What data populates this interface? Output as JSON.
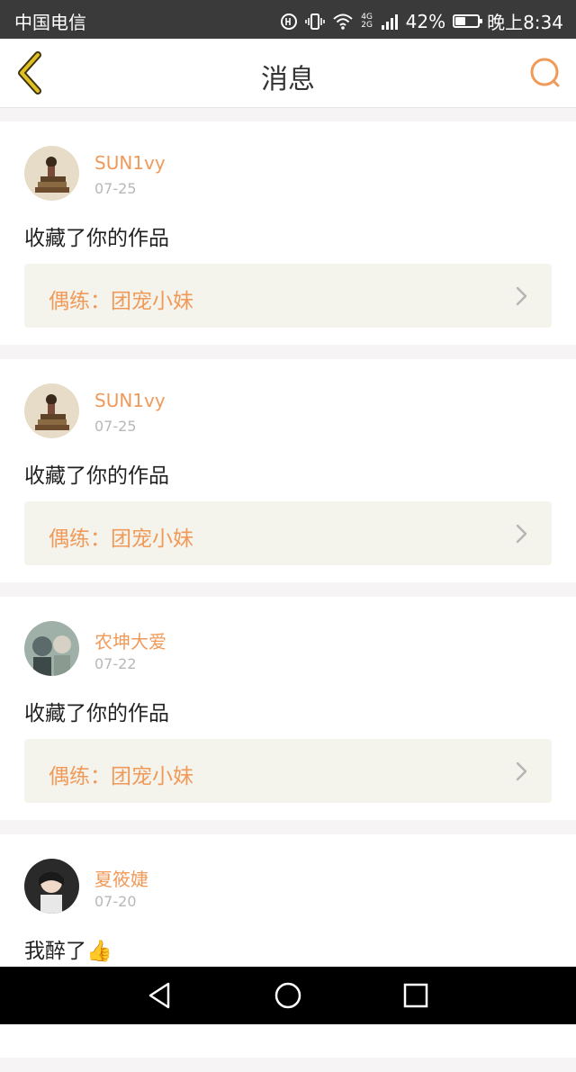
{
  "status_bar": {
    "carrier": "中国电信",
    "network_badge": "4G 2G",
    "battery_percent": "42%",
    "battery_level": 0.42,
    "time": "晚上8:34"
  },
  "header": {
    "title": "消息",
    "back_icon": "chevron-left-icon",
    "search_icon": "search-icon"
  },
  "messages": [
    {
      "username": "SUN1vy",
      "date": "07-25",
      "text": "收藏了你的作品",
      "ref_label": "偶练：团宠小妹"
    },
    {
      "username": "SUN1vy",
      "date": "07-25",
      "text": "收藏了你的作品",
      "ref_label": "偶练：团宠小妹"
    },
    {
      "username": "农坤大爱",
      "date": "07-22",
      "text": "收藏了你的作品",
      "ref_label": "偶练：团宠小妹"
    },
    {
      "username": "夏筱婕",
      "date": "07-20",
      "text": "我醉了",
      "emoji": "👍"
    }
  ],
  "colors": {
    "accent": "#f09a5a",
    "back_icon": "#e0bf22",
    "ref_bg": "#f4f3ec",
    "date": "#b8b8b8"
  }
}
